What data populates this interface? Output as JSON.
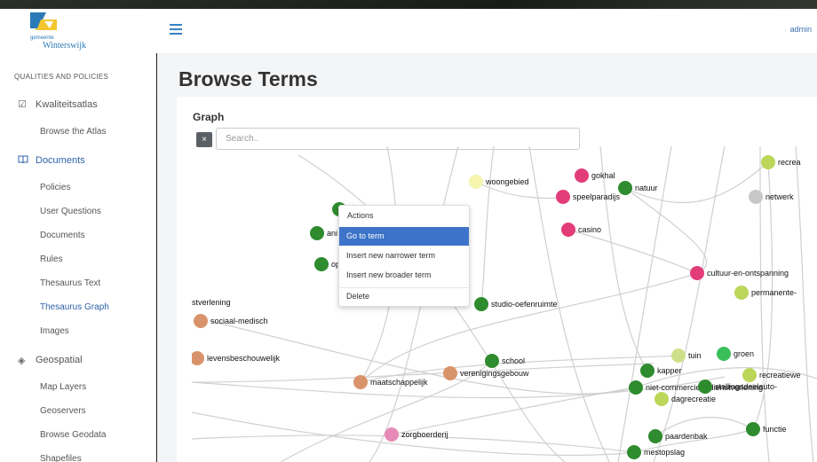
{
  "app": {
    "logo_small": "gemeente",
    "logo_name": "Winterswijk",
    "user": "admin"
  },
  "sidebar": {
    "section_title": "QUALITIES AND POLICIES",
    "groups": [
      {
        "label": "Kwaliteitsatlas",
        "icon": "checkbox-icon",
        "items": [
          "Browse the Atlas"
        ]
      },
      {
        "label": "Documents",
        "icon": "book-icon",
        "items": [
          "Policies",
          "User Questions",
          "Documents",
          "Rules",
          "Thesaurus Text",
          "Thesaurus Graph",
          "Images"
        ]
      },
      {
        "label": "Geospatial",
        "icon": "layers-icon",
        "items": [
          "Map Layers",
          "Geoservers",
          "Browse Geodata",
          "Shapefiles"
        ]
      }
    ],
    "active_item": "Thesaurus Graph"
  },
  "page": {
    "title": "Browse Terms",
    "graph_label": "Graph",
    "clear_label": "×",
    "search_placeholder": "Search..",
    "search_value": ""
  },
  "context_menu": {
    "title": "Actions",
    "items": [
      "Go to term",
      "Insert new narrower term",
      "Insert new broader term",
      "Delete"
    ],
    "highlighted": "Go to term"
  },
  "graph": {
    "nodes": [
      {
        "label": "woongebied",
        "color": "#f5f5b0"
      },
      {
        "label": "gokhal",
        "color": "#e33d79"
      },
      {
        "label": "speelparadijs",
        "color": "#e33d79"
      },
      {
        "label": "natuur",
        "color": "#2e8b2e"
      },
      {
        "label": "casino",
        "color": "#e33d79"
      },
      {
        "label": "recrea",
        "color": "#bcd65a"
      },
      {
        "label": "netwerk",
        "color": "#c8c8c8"
      },
      {
        "label": "cultuur-en-ontspanning",
        "color": "#e33d79"
      },
      {
        "label": "permanente-",
        "color": "#bcd65a"
      },
      {
        "label": "ani",
        "color": "#2e8b2e"
      },
      {
        "label": "op",
        "color": "#2e8b2e"
      },
      {
        "label": "",
        "color": "#2e8b2e"
      },
      {
        "label": "studio-oefenruimte",
        "color": "#2e8b2e"
      },
      {
        "label": "stverlening",
        "color": "#d9936a"
      },
      {
        "label": "sociaal-medisch",
        "color": "#d9936a"
      },
      {
        "label": "levensbeschouwelijk",
        "color": "#d9936a"
      },
      {
        "label": "school",
        "color": "#2e8b2e"
      },
      {
        "label": "verenigingsgebouw",
        "color": "#d9936a"
      },
      {
        "label": "maatschappelijk",
        "color": "#d9936a"
      },
      {
        "label": "tuin",
        "color": "#cfe08a"
      },
      {
        "label": "groen",
        "color": "#3bbf5b"
      },
      {
        "label": "kapper",
        "color": "#2e8b2e"
      },
      {
        "label": "recreatiewe",
        "color": "#bcd65a"
      },
      {
        "label": "niet-commerciele-dienstverlening",
        "color": "#2e8b2e"
      },
      {
        "label": "stallingsdeelauto-",
        "color": "#2e8b2e"
      },
      {
        "label": "dagrecreatie",
        "color": "#bcd65a"
      },
      {
        "label": "zorgboerderij",
        "color": "#e88ab8"
      },
      {
        "label": "paardenbak",
        "color": "#2e8b2e"
      },
      {
        "label": "functie",
        "color": "#2e8b2e"
      },
      {
        "label": "mestopslag",
        "color": "#2e8b2e"
      }
    ]
  }
}
